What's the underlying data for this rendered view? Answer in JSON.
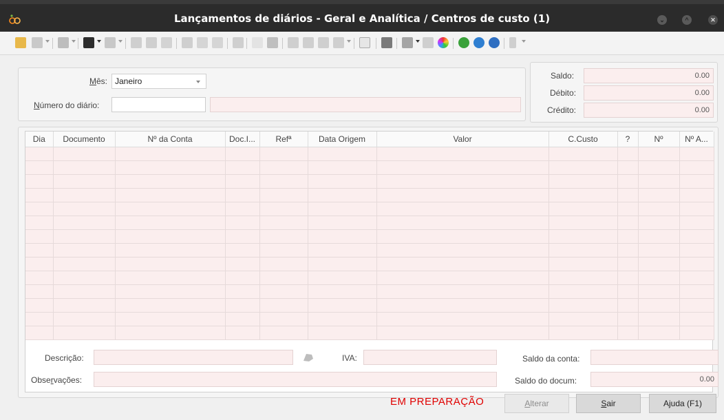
{
  "window": {
    "title": "Lançamentos de diários - Geral e Analítica / Centros de custo (1)",
    "buttons": {
      "minimize": "⌄",
      "maximize": "^",
      "close": "✕"
    }
  },
  "header": {
    "mes_label_u": "M",
    "mes_label_rest": "ês:",
    "mes_value": "Janeiro",
    "numero_label_u": "N",
    "numero_label_rest": "úmero do diário:",
    "numero_value": "",
    "numero_desc": ""
  },
  "totals": {
    "saldo_label": "Saldo:",
    "saldo_value": "0.00",
    "debito_label": "Débito:",
    "debito_value": "0.00",
    "credito_label": "Crédito:",
    "credito_value": "0.00"
  },
  "grid": {
    "columns": [
      "Dia",
      "Documento",
      "Nº da Conta",
      "Doc.I...",
      "Refª",
      "Data Origem",
      "Valor",
      "C.Custo",
      "?",
      "Nº",
      "Nº A..."
    ],
    "row_count": 14
  },
  "footer": {
    "descricao_label": "Descrição:",
    "observacoes_pre": "Obse",
    "observacoes_u": "r",
    "observacoes_post": "vações:",
    "iva_label": "IVA:",
    "saldo_conta_label": "Saldo da conta:",
    "saldo_conta_value": "",
    "saldo_docum_label": "Saldo do docum:",
    "saldo_docum_value": "0.00",
    "status_text": "EM PREPARAÇÃO"
  },
  "buttons": {
    "alterar_u": "A",
    "alterar_rest": "lterar",
    "sair_u": "S",
    "sair_rest": "air",
    "ajuda_label": "Ajuda (F1)"
  },
  "colors": {
    "status_red": "#e00000",
    "field_pink": "#fbeeee",
    "titlebar": "#2b2b2b"
  }
}
